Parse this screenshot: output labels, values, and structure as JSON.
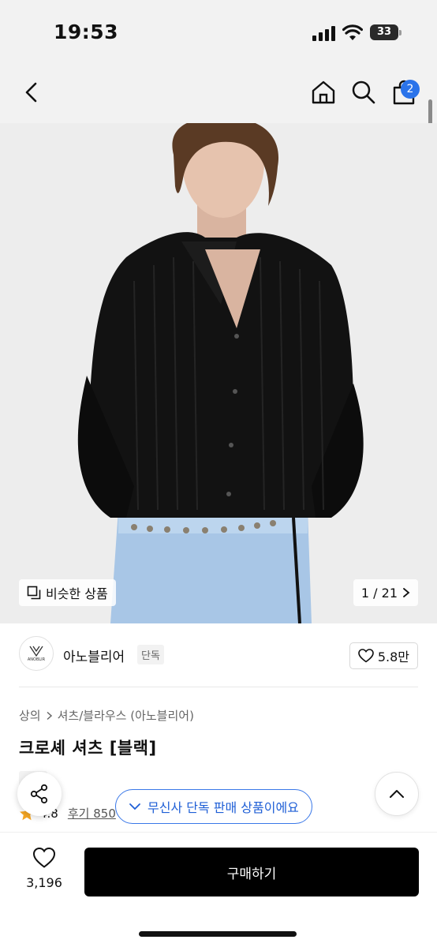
{
  "status_bar": {
    "time": "19:53",
    "battery": "33",
    "icons": [
      "cellular-signal-icon",
      "wifi-icon",
      "battery-icon"
    ]
  },
  "nav": {
    "icons": [
      "back-chevron-icon",
      "home-icon",
      "search-icon",
      "shopping-bag-icon"
    ],
    "cart_count": "2",
    "accent": "#2a73ea"
  },
  "hero": {
    "similar_label": "비슷한 상품",
    "pager": "1 / 21"
  },
  "brand": {
    "logo_text": "ANOBLIR",
    "name": "아노블리어",
    "tag": "단독",
    "likes": "5.8만"
  },
  "product": {
    "breadcrumb": [
      "상의",
      "셔츠/블라우스 (아노블리어)"
    ],
    "title": "크로셰 셔츠 [블랙]",
    "exclusive_tag": "단독",
    "rating": "4.8",
    "review_label": "후기 850"
  },
  "floating": {
    "toast": "무신사 단독 판매 상품이에요",
    "toast_color": "#3a78e8"
  },
  "bottom": {
    "wish_count": "3,196",
    "buy_label": "구매하기"
  }
}
